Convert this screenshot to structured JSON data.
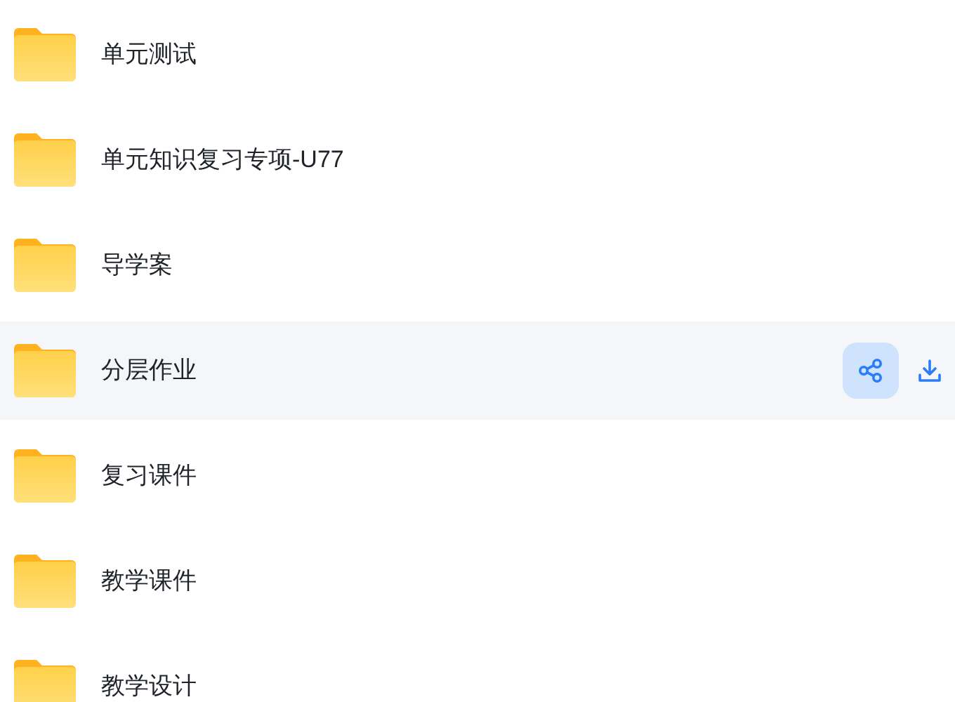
{
  "folders": [
    {
      "name": "单元测试",
      "selected": false
    },
    {
      "name": "单元知识复习专项-U77",
      "selected": false
    },
    {
      "name": "导学案",
      "selected": false
    },
    {
      "name": "分层作业",
      "selected": true
    },
    {
      "name": "复习课件",
      "selected": false
    },
    {
      "name": "教学课件",
      "selected": false
    },
    {
      "name": "教学设计",
      "selected": false
    }
  ]
}
